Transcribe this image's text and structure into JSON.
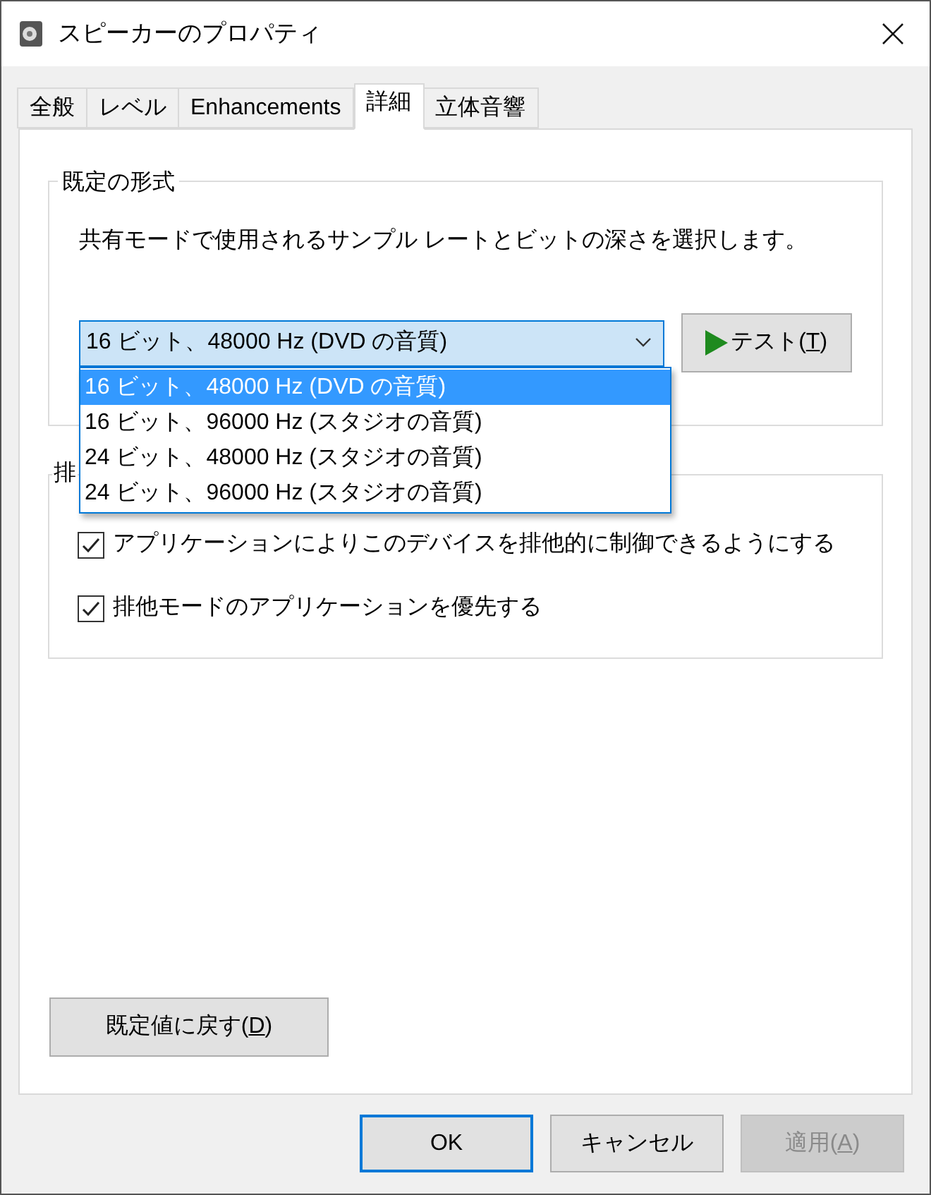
{
  "window": {
    "title": "スピーカーのプロパティ"
  },
  "tabs": [
    {
      "label": "全般",
      "selected": false
    },
    {
      "label": "レベル",
      "selected": false
    },
    {
      "label": "Enhancements",
      "selected": false
    },
    {
      "label": "詳細",
      "selected": true
    },
    {
      "label": "立体音響",
      "selected": false
    }
  ],
  "default_format": {
    "title": "既定の形式",
    "description": "共有モードで使用されるサンプル レートとビットの深さを選択します。",
    "combo": {
      "value": "16 ビット、48000 Hz (DVD の音質)",
      "expanded": true,
      "options": [
        {
          "label": "16 ビット、48000 Hz (DVD の音質)",
          "selected": true
        },
        {
          "label": "16 ビット、96000 Hz (スタジオの音質)",
          "selected": false
        },
        {
          "label": "24 ビット、48000 Hz (スタジオの音質)",
          "selected": false
        },
        {
          "label": "24 ビット、96000 Hz (スタジオの音質)",
          "selected": false
        }
      ]
    },
    "test_button": {
      "before": "テスト(",
      "key": "T",
      "after": ")"
    }
  },
  "exclusive_mode": {
    "title": "排",
    "options": [
      {
        "label": "アプリケーションによりこのデバイスを排他的に制御できるようにする",
        "checked": true
      },
      {
        "label": "排他モードのアプリケーションを優先する",
        "checked": true
      }
    ]
  },
  "restore_button": {
    "before": "既定値に戻す(",
    "key": "D",
    "after": ")"
  },
  "buttons": [
    {
      "kind": "default",
      "label": {
        "before": "OK"
      },
      "disabled": false
    },
    {
      "kind": "normal",
      "label": {
        "before": "キャンセル"
      },
      "disabled": false
    },
    {
      "kind": "normal",
      "label": {
        "before": "適用(",
        "key": "A",
        "after": ")"
      },
      "disabled": true
    }
  ]
}
